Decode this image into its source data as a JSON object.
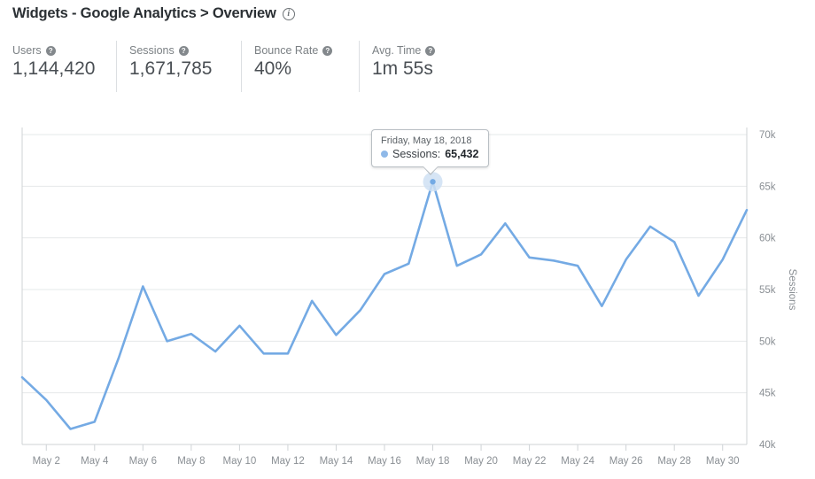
{
  "header": {
    "title": "Widgets - Google Analytics > Overview",
    "info_icon": "info-icon",
    "metrics": [
      {
        "label": "Users",
        "value": "1,144,420",
        "help": "?"
      },
      {
        "label": "Sessions",
        "value": "1,671,785",
        "help": "?"
      },
      {
        "label": "Bounce Rate",
        "value": "40%",
        "help": "?"
      },
      {
        "label": "Avg. Time",
        "value": "1m 55s",
        "help": "?"
      }
    ]
  },
  "tooltip": {
    "date": "Friday, May 18, 2018",
    "metric_label": "Sessions:",
    "value": "65,432",
    "bullet_color": "#8fb9e8"
  },
  "chart_data": {
    "type": "line",
    "title": "",
    "xlabel": "",
    "ylabel": "Sessions",
    "ylim": [
      40000,
      70000
    ],
    "y_ticks": [
      40000,
      45000,
      50000,
      55000,
      60000,
      65000,
      70000
    ],
    "y_tick_labels": [
      "40k",
      "45k",
      "50k",
      "55k",
      "60k",
      "65k",
      "70k"
    ],
    "x_tick_labels": [
      "May 2",
      "May 4",
      "May 6",
      "May 8",
      "May 10",
      "May 12",
      "May 14",
      "May 16",
      "May 18",
      "May 20",
      "May 22",
      "May 24",
      "May 26",
      "May 28",
      "May 30"
    ],
    "x_tick_days": [
      2,
      4,
      6,
      8,
      10,
      12,
      14,
      16,
      18,
      20,
      22,
      24,
      26,
      28,
      30
    ],
    "x_domain_days": [
      1,
      31
    ],
    "grid": true,
    "legend": "none",
    "line_color": "#74aae4",
    "grid_color": "#e6e8ea",
    "series": [
      {
        "name": "Sessions",
        "x": [
          1,
          2,
          3,
          4,
          5,
          6,
          7,
          8,
          9,
          10,
          11,
          12,
          13,
          14,
          15,
          16,
          17,
          18,
          19,
          20,
          21,
          22,
          23,
          24,
          25,
          26,
          27,
          28,
          29,
          30,
          31
        ],
        "values": [
          46500,
          44300,
          41500,
          42200,
          48400,
          55300,
          50000,
          50700,
          49000,
          51500,
          48800,
          48800,
          53900,
          50600,
          53000,
          56500,
          57500,
          65432,
          57300,
          58400,
          61400,
          58100,
          57800,
          57300,
          53400,
          57900,
          61100,
          59600,
          54400,
          57900,
          62700
        ]
      }
    ],
    "highlight": {
      "x": 18,
      "y": 65432
    }
  }
}
